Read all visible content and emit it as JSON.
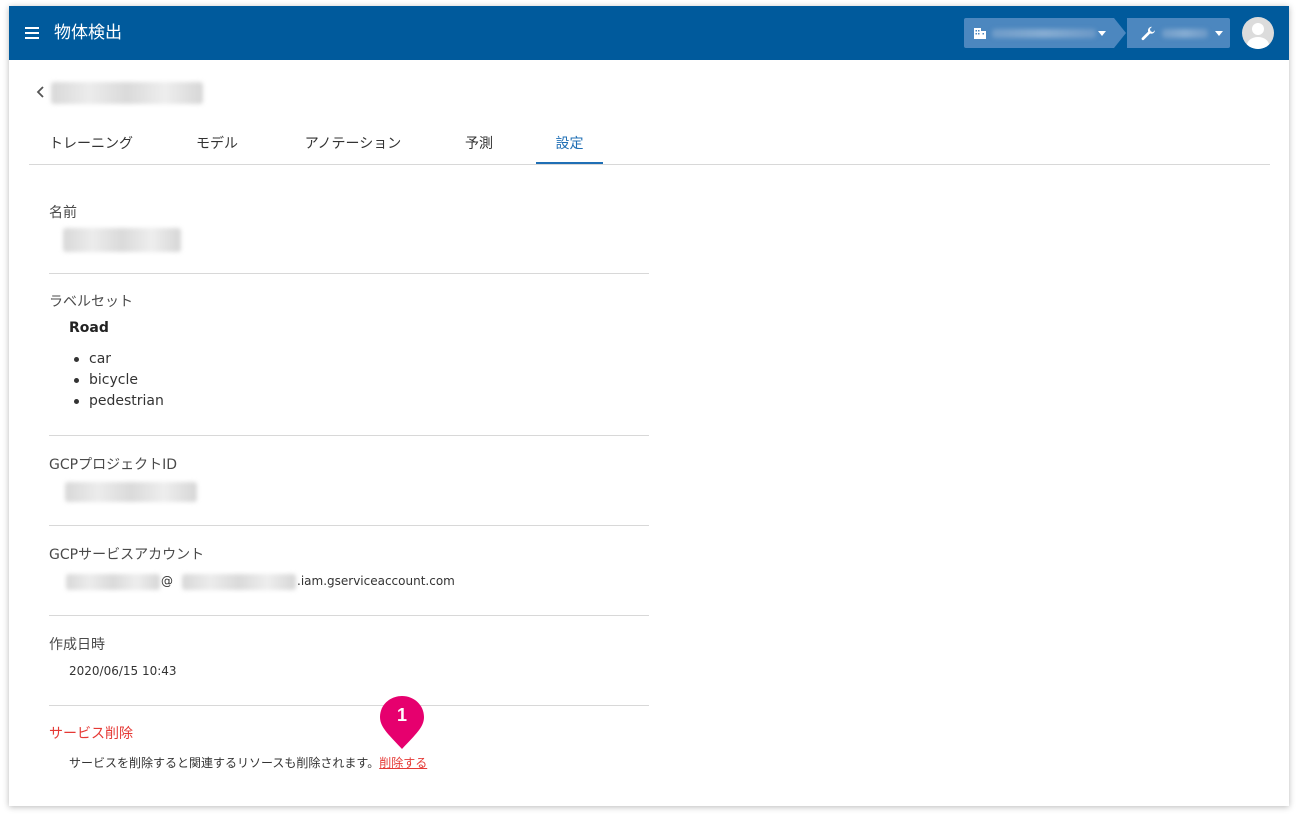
{
  "app": {
    "title": "物体検出",
    "accent_color": "#005a9c",
    "icons": {
      "menu": "hamburger-menu-icon",
      "org": "building-icon",
      "tool": "wrench-icon",
      "avatar": "user-avatar-icon",
      "back": "chevron-left-icon"
    }
  },
  "tabs": [
    {
      "label": "トレーニング",
      "active": false
    },
    {
      "label": "モデル",
      "active": false
    },
    {
      "label": "アノテーション",
      "active": false
    },
    {
      "label": "予測",
      "active": false
    },
    {
      "label": "設定",
      "active": true
    }
  ],
  "settings": {
    "name": {
      "label": "名前"
    },
    "label_set": {
      "label": "ラベルセット",
      "name": "Road",
      "items": [
        "car",
        "bicycle",
        "pedestrian"
      ]
    },
    "gcp_project": {
      "label": "GCPプロジェクトID"
    },
    "gcp_service_account": {
      "label": "GCPサービスアカウント",
      "at": "@",
      "domain_suffix": ".iam.gserviceaccount.com"
    },
    "created_at": {
      "label": "作成日時",
      "value": "2020/06/15 10:43"
    },
    "delete_service": {
      "label": "サービス削除",
      "description": "サービスを削除すると関連するリソースも削除されます。",
      "link_label": "削除する",
      "danger_color": "#e53935"
    }
  },
  "annotation": {
    "marker_number": "1",
    "marker_color": "#e6006e"
  }
}
